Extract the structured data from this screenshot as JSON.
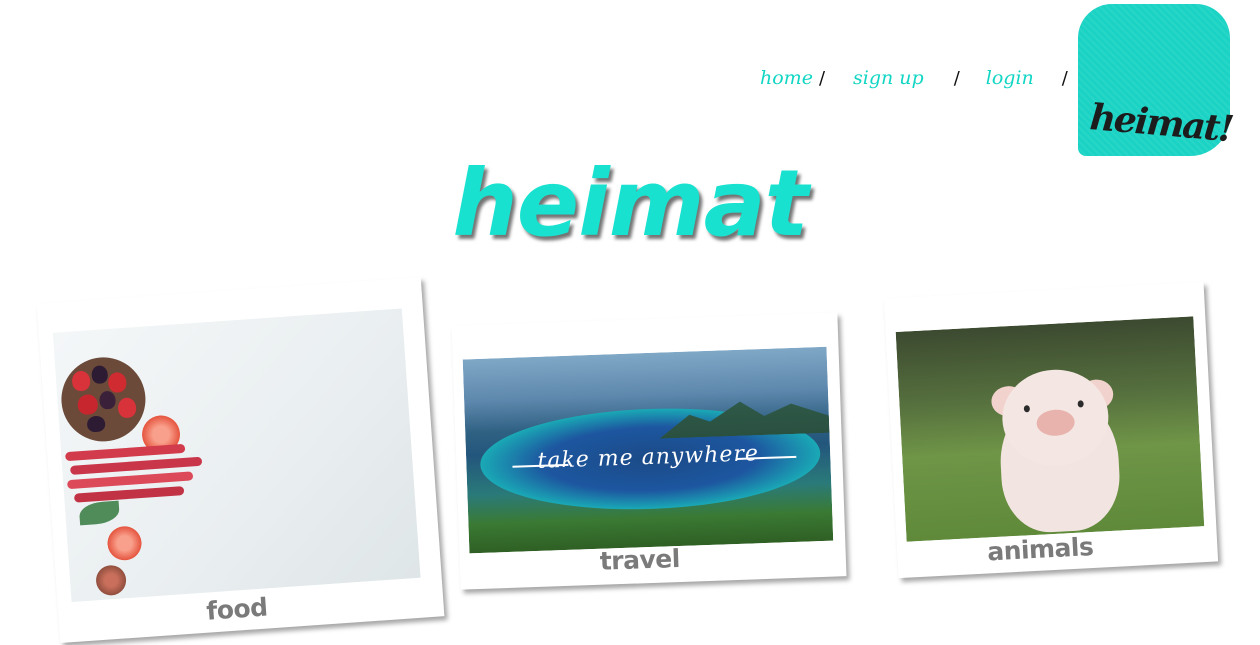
{
  "nav": {
    "items": [
      {
        "label": "home"
      },
      {
        "label": "sign up"
      },
      {
        "label": "login"
      }
    ],
    "separator": "/"
  },
  "logo": {
    "text": "heimat!"
  },
  "hero": {
    "title": "heimat"
  },
  "cards": {
    "food": {
      "caption": "food"
    },
    "travel": {
      "caption": "travel",
      "overlay_text": "take me anywhere"
    },
    "animals": {
      "caption": "animals"
    }
  },
  "colors": {
    "accent": "#1ad3c4",
    "hero": "#18e2cf",
    "caption": "#7a7a7a"
  }
}
